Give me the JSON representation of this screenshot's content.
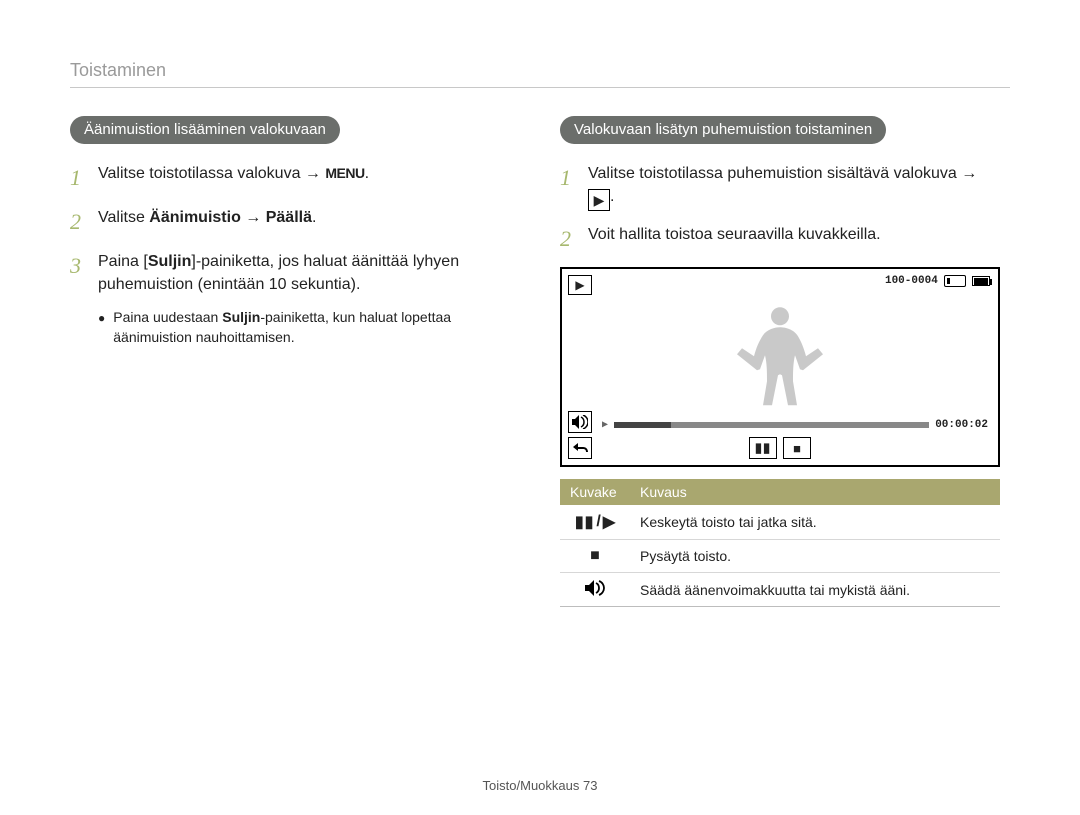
{
  "section_title": "Toistaminen",
  "left": {
    "pill": "Äänimuistion lisääminen valokuvaan",
    "steps": [
      {
        "num": "1",
        "pre": "Valitse toistotilassa valokuva → ",
        "menu_glyph": "MENU",
        "post": "."
      },
      {
        "num": "2",
        "pre": "Valitse ",
        "bold1": "Äänimuistio",
        "mid": " → ",
        "bold2": "Päällä",
        "post": "."
      },
      {
        "num": "3",
        "pre": "Paina [",
        "bold1": "Suljin",
        "mid": "]-painiketta, jos haluat äänittää lyhyen puhemuistion (enintään 10 sekuntia).",
        "bold2": "",
        "post": ""
      }
    ],
    "bullet": {
      "pre": "Paina uudestaan ",
      "bold": "Suljin",
      "post": "-painiketta, kun haluat lopettaa äänimuistion nauhoittamisen."
    }
  },
  "right": {
    "pill": "Valokuvaan lisätyn puhemuistion toistaminen",
    "steps": [
      {
        "num": "1",
        "text": "Valitse toistotilassa puhemuistion sisältävä valokuva → ",
        "icon": "play"
      },
      {
        "num": "2",
        "text": "Voit hallita toistoa seuraavilla kuvakkeilla."
      }
    ],
    "device": {
      "counter": "100-0004",
      "time": "00:00:02"
    },
    "table": {
      "headers": {
        "icon": "Kuvake",
        "desc": "Kuvaus"
      },
      "rows": [
        {
          "icon": "pauseplay",
          "desc": "Keskeytä toisto tai jatka sitä."
        },
        {
          "icon": "stop",
          "desc": "Pysäytä toisto."
        },
        {
          "icon": "volume",
          "desc": "Säädä äänenvoimakkuutta tai mykistä ääni."
        }
      ]
    }
  },
  "footer": {
    "text": "Toisto/Muokkaus  73"
  }
}
